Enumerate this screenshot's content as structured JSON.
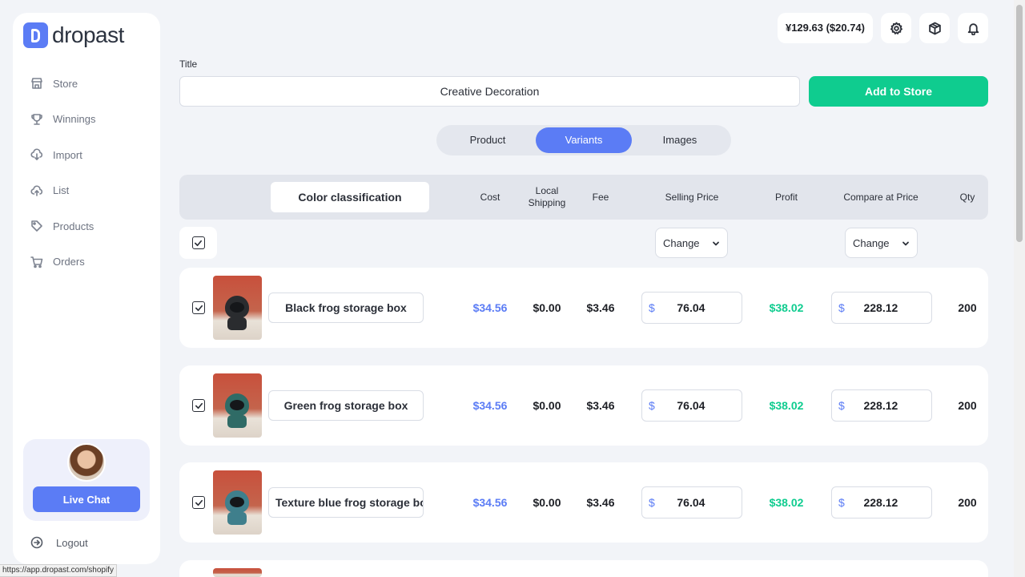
{
  "app": {
    "logo_text": "dropast"
  },
  "sidebar": {
    "items": [
      {
        "label": "Store",
        "icon": "store-icon"
      },
      {
        "label": "Winnings",
        "icon": "trophy-icon"
      },
      {
        "label": "Import",
        "icon": "cloud-download-icon"
      },
      {
        "label": "List",
        "icon": "cloud-upload-icon"
      },
      {
        "label": "Products",
        "icon": "tag-icon"
      },
      {
        "label": "Orders",
        "icon": "cart-icon"
      }
    ],
    "live_chat_label": "Live Chat",
    "logout_label": "Logout"
  },
  "header": {
    "balance": "¥129.63 ($20.74)",
    "icons": [
      "gear-icon",
      "box-icon",
      "bell-icon"
    ]
  },
  "form": {
    "title_label": "Title",
    "title_value": "Creative Decoration",
    "add_to_store_label": "Add to Store"
  },
  "tabs": [
    {
      "label": "Product",
      "active": false
    },
    {
      "label": "Variants",
      "active": true
    },
    {
      "label": "Images",
      "active": false
    }
  ],
  "table": {
    "headers": {
      "color_classification": "Color classification",
      "cost": "Cost",
      "local_shipping": "Local Shipping",
      "fee": "Fee",
      "selling_price": "Selling Price",
      "profit": "Profit",
      "compare_at_price": "Compare at Price",
      "qty": "Qty"
    },
    "change_label": "Change",
    "currency_symbol": "$",
    "rows": [
      {
        "name": "Black frog storage box",
        "cost": "$34.56",
        "shipping": "$0.00",
        "fee": "$3.46",
        "selling_price": "76.04",
        "profit": "$38.02",
        "compare_price": "228.12",
        "qty": "200",
        "checked": true
      },
      {
        "name": "Green frog storage box",
        "cost": "$34.56",
        "shipping": "$0.00",
        "fee": "$3.46",
        "selling_price": "76.04",
        "profit": "$38.02",
        "compare_price": "228.12",
        "qty": "200",
        "checked": true
      },
      {
        "name": "Texture blue frog storage box",
        "cost": "$34.56",
        "shipping": "$0.00",
        "fee": "$3.46",
        "selling_price": "76.04",
        "profit": "$38.02",
        "compare_price": "228.12",
        "qty": "200",
        "checked": true
      }
    ]
  },
  "colors": {
    "accent": "#5b7cf5",
    "success": "#0fcc8f",
    "frog_black": "#2a2c2f",
    "frog_green": "#2f6b66",
    "frog_blue": "#3f7f8c"
  },
  "status_url": "https://app.dropast.com/shopify"
}
